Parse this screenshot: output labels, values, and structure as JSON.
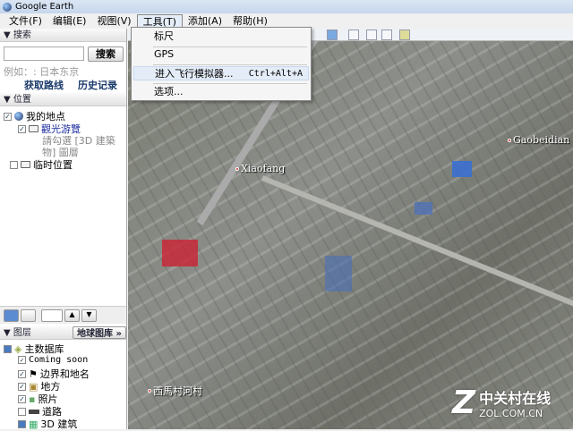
{
  "window": {
    "title": "Google Earth"
  },
  "menubar": [
    "文件(F)",
    "编辑(E)",
    "视图(V)",
    "工具(T)",
    "添加(A)",
    "帮助(H)"
  ],
  "dropdown": {
    "items": [
      "标尺",
      "GPS",
      "进入飞行模拟器...",
      "选项..."
    ],
    "shortcut": "Ctrl+Alt+A"
  },
  "search": {
    "header": "▼ 搜索",
    "button": "搜索",
    "example": "例如：: 日本东京",
    "link1": "获取路线",
    "link2": "历史记录",
    "value": ""
  },
  "places": {
    "header": "▼ 位置",
    "my_places": "我的地点",
    "tour": "觀光游覽",
    "tour_desc1": "請勾選 [3D 建築",
    "tour_desc2": "物] 圖層",
    "temp": "临时位置"
  },
  "layers": {
    "header": "▼ 图层",
    "gallery": "地球图库 »",
    "items": [
      "主数据库",
      "Coming soon",
      "边界和地名",
      "地方",
      "照片",
      "道路",
      "3D 建筑"
    ]
  },
  "map": {
    "labels": [
      "Xiaofang",
      "Gaobeidian",
      "西馬村河村"
    ]
  },
  "watermark": {
    "cn": "中关村在线",
    "en": "ZOL.COM.CN"
  }
}
